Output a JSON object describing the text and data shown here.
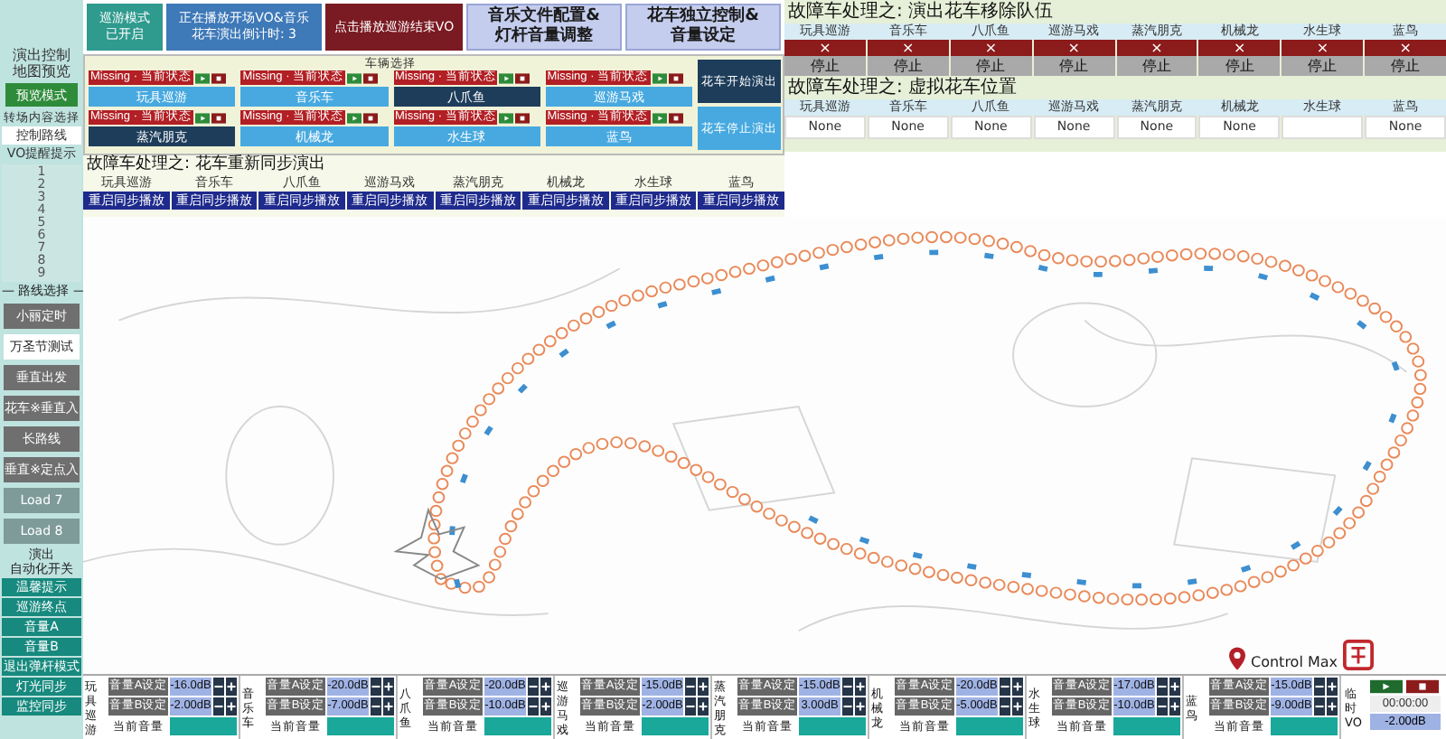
{
  "top_buttons": [
    {
      "kind": "mode",
      "lines": [
        "巡游模式",
        "已开启"
      ]
    },
    {
      "kind": "status",
      "lines": [
        "正在播放开场VO&音乐",
        "花车演出倒计时: 3"
      ]
    },
    {
      "kind": "action",
      "lines": [
        "点击播放巡游结束VO"
      ]
    },
    {
      "kind": "config",
      "lines": [
        "音乐文件配置&",
        "灯杆音量调整"
      ]
    },
    {
      "kind": "config",
      "lines": [
        "花车独立控制&",
        "音量设定"
      ]
    }
  ],
  "sidebar": {
    "title_lines": [
      "演出控制",
      "地图预览"
    ],
    "preview_button": "预览模式",
    "content_label": "转场内容选择",
    "route_control": "控制路线",
    "vo_title": "VO提醒提示",
    "vo_list": [
      "1",
      "2",
      "3",
      "4",
      "5",
      "6",
      "7",
      "8",
      "9"
    ],
    "route_title": "— 路线选择 —",
    "route_buttons": [
      {
        "label": "小丽定时",
        "selected": false,
        "disabled": false
      },
      {
        "label": "万圣节测试",
        "selected": true,
        "disabled": false
      },
      {
        "label": "垂直出发",
        "selected": false,
        "disabled": false
      },
      {
        "label": "花车※垂直入",
        "selected": false,
        "disabled": false
      },
      {
        "label": "长路线",
        "selected": false,
        "disabled": false
      },
      {
        "label": "垂直※定点入",
        "selected": false,
        "disabled": false
      },
      {
        "label": "Load 7",
        "selected": false,
        "disabled": true
      },
      {
        "label": "Load 8",
        "selected": false,
        "disabled": true
      }
    ],
    "auto_title_lines": [
      "演出",
      "自动化开关"
    ],
    "auto_buttons": [
      "温馨提示",
      "巡游终点",
      "音量A",
      "音量B",
      "退出弹杆模式",
      "灯光同步",
      "监控同步"
    ]
  },
  "vehicle_panel": {
    "title": "车辆选择",
    "vehicles": [
      {
        "status": "Missing · 当前状态",
        "name": "玩具巡游",
        "selected": false
      },
      {
        "status": "Missing · 当前状态",
        "name": "音乐车",
        "selected": false
      },
      {
        "status": "Missing · 当前状态",
        "name": "八爪鱼",
        "selected": true
      },
      {
        "status": "Missing · 当前状态",
        "name": "巡游马戏",
        "selected": false
      },
      {
        "status": "Missing · 当前状态",
        "name": "蒸汽朋克",
        "selected": true
      },
      {
        "status": "Missing · 当前状态",
        "name": "机械龙",
        "selected": false
      },
      {
        "status": "Missing · 当前状态",
        "name": "水生球",
        "selected": false
      },
      {
        "status": "Missing · 当前状态",
        "name": "蓝鸟",
        "selected": false
      }
    ],
    "show_buttons": [
      {
        "label": "花车开始演出",
        "selected": true
      },
      {
        "label": "花车停止演出",
        "selected": false
      }
    ]
  },
  "sync": {
    "title": "故障车处理之: 花车重新同步演出",
    "columns": [
      {
        "name": "玩具巡游",
        "button": "重启同步播放"
      },
      {
        "name": "音乐车",
        "button": "重启同步播放"
      },
      {
        "name": "八爪鱼",
        "button": "重启同步播放"
      },
      {
        "name": "巡游马戏",
        "button": "重启同步播放"
      },
      {
        "name": "蒸汽朋克",
        "button": "重启同步播放"
      },
      {
        "name": "机械龙",
        "button": "重启同步播放"
      },
      {
        "name": "水生球",
        "button": "重启同步播放"
      },
      {
        "name": "蓝鸟",
        "button": "重启同步播放"
      }
    ]
  },
  "remove": {
    "title": "故障车处理之: 演出花车移除队伍",
    "columns": [
      {
        "name": "玩具巡游",
        "mark": "×",
        "stop": "停止"
      },
      {
        "name": "音乐车",
        "mark": "×",
        "stop": "停止"
      },
      {
        "name": "八爪鱼",
        "mark": "×",
        "stop": "停止"
      },
      {
        "name": "巡游马戏",
        "mark": "×",
        "stop": "停止"
      },
      {
        "name": "蒸汽朋克",
        "mark": "×",
        "stop": "停止"
      },
      {
        "name": "机械龙",
        "mark": "×",
        "stop": "停止"
      },
      {
        "name": "水生球",
        "mark": "×",
        "stop": "停止"
      },
      {
        "name": "蓝鸟",
        "mark": "×",
        "stop": "停止"
      }
    ]
  },
  "virtual": {
    "title": "故障车处理之: 虚拟花车位置",
    "columns": [
      {
        "name": "玩具巡游",
        "value": "None"
      },
      {
        "name": "音乐车",
        "value": "None"
      },
      {
        "name": "八爪鱼",
        "value": "None"
      },
      {
        "name": "巡游马戏",
        "value": "None"
      },
      {
        "name": "蒸汽朋克",
        "value": "None"
      },
      {
        "name": "机械龙",
        "value": "None"
      },
      {
        "name": "水生球"
      },
      {
        "name": "蓝鸟",
        "value": "None"
      }
    ]
  },
  "logo": "Control Max",
  "volume": {
    "channels": [
      {
        "name_lines": [
          "玩具",
          "巡游"
        ],
        "a_label": "音量A设定",
        "a_value": "-16.0dB",
        "b_label": "音量B设定",
        "b_value": "-2.00dB",
        "current_label": "当前音量",
        "level": 1
      },
      {
        "name_lines": [
          "音乐",
          "车"
        ],
        "a_label": "音量A设定",
        "a_value": "-20.0dB",
        "b_label": "音量B设定",
        "b_value": "-7.00dB",
        "current_label": "当前音量",
        "level": 1
      },
      {
        "name_lines": [
          "八爪",
          "鱼"
        ],
        "a_label": "音量A设定",
        "a_value": "-20.0dB",
        "b_label": "音量B设定",
        "b_value": "-10.0dB",
        "current_label": "当前音量",
        "level": 1
      },
      {
        "name_lines": [
          "巡游",
          "马戏"
        ],
        "a_label": "音量A设定",
        "a_value": "-15.0dB",
        "b_label": "音量B设定",
        "b_value": "-2.00dB",
        "current_label": "当前音量",
        "level": 1
      },
      {
        "name_lines": [
          "蒸汽",
          "朋克"
        ],
        "a_label": "音量A设定",
        "a_value": "-15.0dB",
        "b_label": "音量B设定",
        "b_value": "3.00dB",
        "current_label": "当前音量",
        "level": 1
      },
      {
        "name_lines": [
          "机械",
          "龙"
        ],
        "a_label": "音量A设定",
        "a_value": "-20.0dB",
        "b_label": "音量B设定",
        "b_value": "-5.00dB",
        "current_label": "当前音量",
        "level": 1
      },
      {
        "name_lines": [
          "水生",
          "球"
        ],
        "a_label": "音量A设定",
        "a_value": "-17.0dB",
        "b_label": "音量B设定",
        "b_value": "-10.0dB",
        "current_label": "当前音量",
        "level": 1
      },
      {
        "name_lines": [
          "蓝鸟"
        ],
        "a_label": "音量A设定",
        "a_value": "-15.0dB",
        "b_label": "音量B设定",
        "b_value": "-9.00dB",
        "current_label": "当前音量",
        "level": 1
      }
    ],
    "temp_vo": {
      "name_lines": [
        "临时",
        "VO"
      ],
      "time": "00:00:00",
      "value": "-2.00dB"
    }
  }
}
